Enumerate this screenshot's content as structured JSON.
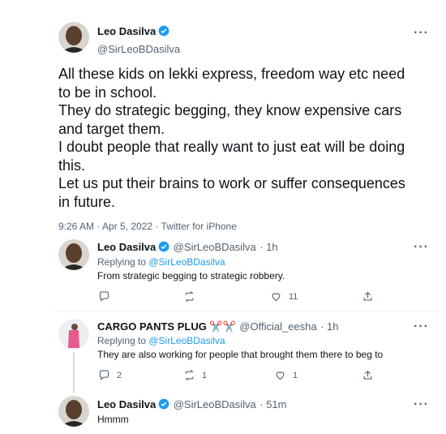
{
  "main_tweet": {
    "author_name": "Leo Dasilva",
    "author_handle": "@SirLeoBDasilva",
    "text_lines": [
      "All these kids on lekki express, freedom way etc need",
      "to be in school.",
      "They do strategic begging, they know expensive cars",
      "and target them.",
      "I doubt people that really want to just eat will be doing",
      "this.",
      "Let us put their brains to work or suffer consequences",
      "in future."
    ],
    "timestamp": "9:26 AM · Apr 5, 2022 · Twitter for iPhone",
    "more_icon": "more-horizontal-icon"
  },
  "replies": [
    {
      "author_name": "Leo Dasilva",
      "author_handle": "@SirLeoBDasilva",
      "time": "· 1h",
      "replying_to_label": "Replying to ",
      "replying_to_handle": "@SirLeoBDasilva",
      "text": "From strategic begging to strategic robbery.",
      "actions": {
        "reply_count": "",
        "retweet_count": "",
        "like_count": "11"
      }
    },
    {
      "author_name": "CARGO PANTS PLUG ✂️✂️",
      "author_handle": "@Official_eesha",
      "time": "· 1h",
      "replying_to_label": "Replying to ",
      "replying_to_handle": "@SirLeoBDasilva",
      "text": "They are also working for people that brought them there to beg to",
      "actions": {
        "reply_count": "2",
        "retweet_count": "1",
        "like_count": "1"
      }
    },
    {
      "author_name": "Leo Dasilva",
      "author_handle": "@SirLeoBDasilva",
      "time": "· 51m",
      "text": "Hmmm"
    }
  ],
  "colors": {
    "accent": "#1d9bf0",
    "muted": "#536471",
    "text": "#0f1419",
    "divider": "#eff3f4"
  }
}
